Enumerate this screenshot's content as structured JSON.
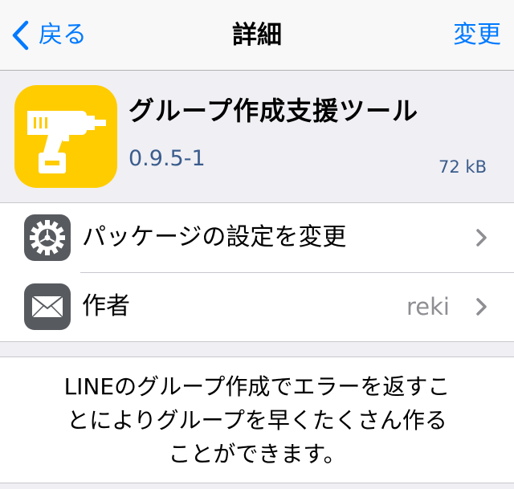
{
  "navbar": {
    "back_label": "戻る",
    "title": "詳細",
    "action_label": "変更"
  },
  "package": {
    "name": "グループ作成支援ツール",
    "version": "0.9.5-1",
    "size": "72 kB"
  },
  "rows": [
    {
      "label": "パッケージの設定を変更",
      "detail": ""
    },
    {
      "label": "作者",
      "detail": "reki"
    }
  ],
  "description": "LINEのグループ作成でエラーを返すこ\nとによりグループを早くたくさん作る\nことができます。",
  "colors": {
    "accent": "#007aff",
    "icon_yellow": "#ffcc00",
    "version_blue": "#3b5c8c",
    "row_icon_gray": "#575a5f"
  }
}
